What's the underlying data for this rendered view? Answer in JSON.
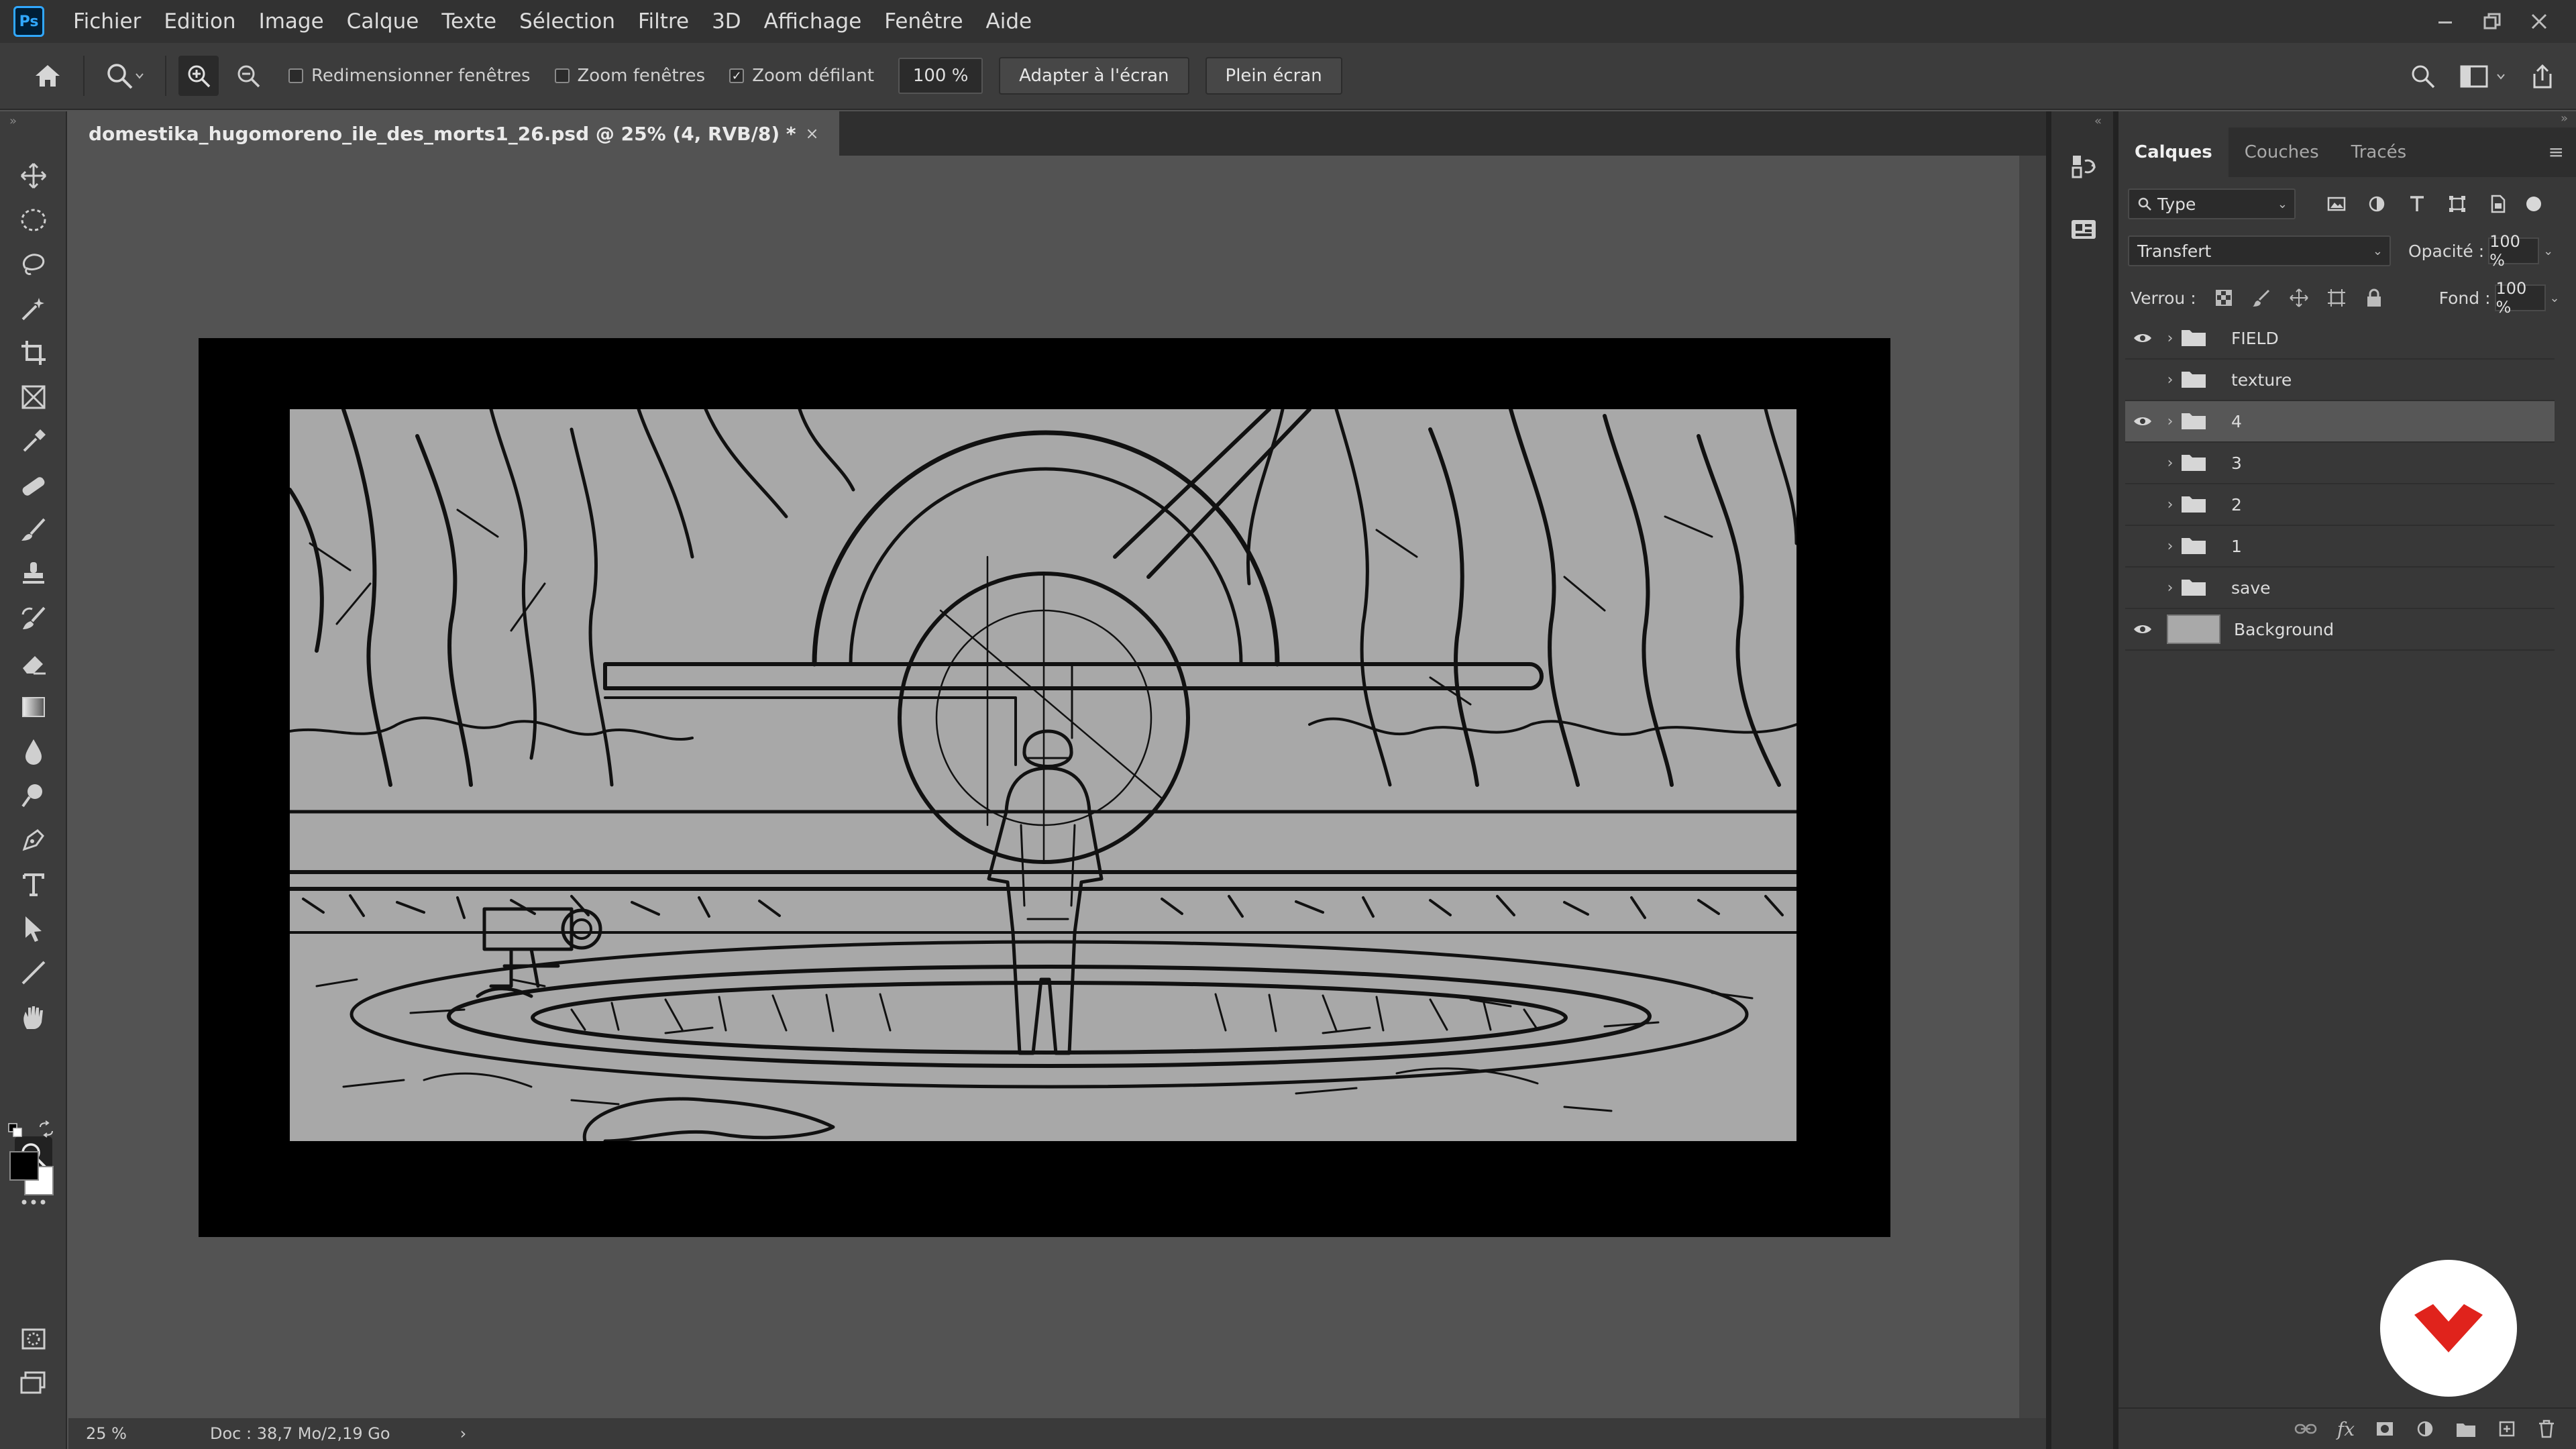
{
  "app": {
    "logo_text": "Ps"
  },
  "menu": [
    "Fichier",
    "Edition",
    "Image",
    "Calque",
    "Texte",
    "Sélection",
    "Filtre",
    "3D",
    "Affichage",
    "Fenêtre",
    "Aide"
  ],
  "options": {
    "resize_windows": "Redimensionner fenêtres",
    "zoom_windows": "Zoom fenêtres",
    "scrubby_zoom": "Zoom défilant",
    "zoom_value": "100 %",
    "fit_screen": "Adapter à l'écran",
    "full_screen": "Plein écran",
    "resize_windows_checked": false,
    "zoom_windows_checked": false,
    "scrubby_zoom_checked": true
  },
  "document": {
    "tab_title": "domestika_hugomoreno_ile_des_morts1_26.psd @ 25% (4, RVB/8) *",
    "close_glyph": "×"
  },
  "status": {
    "zoom": "25 %",
    "doc_info": "Doc : 38,7 Mo/2,19 Go",
    "arrow": "›"
  },
  "layers_panel": {
    "tabs": [
      "Calques",
      "Couches",
      "Tracés"
    ],
    "active_tab": "Calques",
    "filter_type": "Type",
    "blend_mode": "Transfert",
    "opacity_label": "Opacité :",
    "opacity_value": "100 %",
    "lock_label": "Verrou :",
    "fill_label": "Fond :",
    "fill_value": "100 %",
    "layers": [
      {
        "name": "FIELD",
        "visible": true,
        "group": true,
        "selected": false
      },
      {
        "name": "texture",
        "visible": false,
        "group": true,
        "selected": false
      },
      {
        "name": "4",
        "visible": true,
        "group": true,
        "selected": true
      },
      {
        "name": "3",
        "visible": false,
        "group": true,
        "selected": false
      },
      {
        "name": "2",
        "visible": false,
        "group": true,
        "selected": false
      },
      {
        "name": "1",
        "visible": false,
        "group": true,
        "selected": false
      },
      {
        "name": "save",
        "visible": false,
        "group": true,
        "selected": false
      },
      {
        "name": "Background",
        "visible": true,
        "group": false,
        "selected": false
      }
    ]
  },
  "colors": {
    "accent": "#31a8ff",
    "brand_domestika": "#e0231c",
    "foreground_swatch": "#000000",
    "background_swatch": "#ffffff"
  }
}
